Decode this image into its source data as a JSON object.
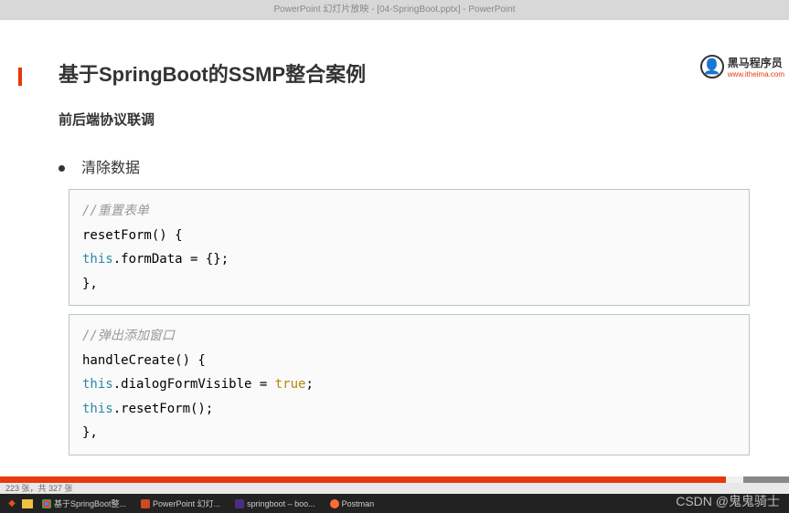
{
  "titlebar": "PowerPoint 幻灯片放映 - [04-SpringBoot.pptx] - PowerPoint",
  "slide": {
    "title": "基于SpringBoot的SSMP整合案例",
    "subtitle": "前后端协议联调",
    "bullet": "清除数据",
    "logo_text": "黑马程序员",
    "logo_url": "www.itheima.com"
  },
  "code1": {
    "comment": "//重置表单",
    "line1": "resetForm() {",
    "line2_pre": "    ",
    "line2_kw": "this",
    "line2_rest": ".formData = {};",
    "line3": "},"
  },
  "code2": {
    "comment": "//弹出添加窗口",
    "line1": "handleCreate() {",
    "line2_pre": "    ",
    "line2_kw": "this",
    "line2_rest": ".dialogFormVisible = ",
    "line2_bool": "true",
    "line2_end": ";",
    "line3_pre": "    ",
    "line3_kw": "this",
    "line3_rest": ".resetForm();",
    "line4": "},"
  },
  "status": "223 张，共 327 张",
  "taskbar": {
    "items": [
      "基于SpringBoot整...",
      "PowerPoint 幻灯...",
      "springboot – boo...",
      "Postman"
    ]
  },
  "watermark": "CSDN @鬼鬼骑士",
  "watermark_top": ""
}
